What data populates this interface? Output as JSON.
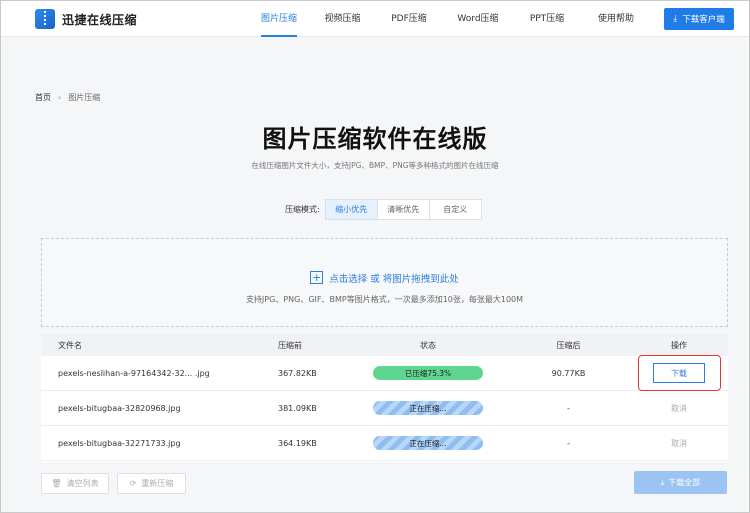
{
  "header": {
    "brand": "迅捷在线压缩",
    "nav": [
      {
        "label": "图片压缩",
        "active": true
      },
      {
        "label": "视频压缩",
        "active": false
      },
      {
        "label": "PDF压缩",
        "active": false
      },
      {
        "label": "Word压缩",
        "active": false
      },
      {
        "label": "PPT压缩",
        "active": false
      },
      {
        "label": "使用帮助",
        "active": false
      }
    ],
    "download_client": "下载客户端"
  },
  "breadcrumb": {
    "home": "首页",
    "current": "图片压缩"
  },
  "page": {
    "title": "图片压缩软件在线版",
    "subtitle": "在线压缩图片文件大小，支持JPG、BMP、PNG等多种格式的图片在线压缩"
  },
  "mode": {
    "label": "压缩模式:",
    "options": [
      "缩小优先",
      "清晰优先",
      "自定义"
    ],
    "selected": "缩小优先"
  },
  "upload": {
    "action": "点击选择 或 将图片拖拽到此处",
    "hint": "支持JPG、PNG、GIF、BMP等图片格式，一次最多添加10张，每张最大100M"
  },
  "table": {
    "headers": [
      "文件名",
      "压缩前",
      "状态",
      "压缩后",
      "操作"
    ],
    "rows": [
      {
        "name": "pexels-neslihan-a-97164342-32... .jpg",
        "before": "367.82KB",
        "state": "已压缩75.3%",
        "state_type": "done",
        "after": "90.77KB",
        "op": "下载"
      },
      {
        "name": "pexels-bitugbaa-32820968.jpg",
        "before": "381.09KB",
        "state": "正在压缩...",
        "state_type": "busy",
        "after": "-",
        "op": "取消"
      },
      {
        "name": "pexels-bitugbaa-32271733.jpg",
        "before": "364.19KB",
        "state": "正在压缩...",
        "state_type": "busy",
        "after": "-",
        "op": "取消"
      }
    ]
  },
  "footer": {
    "clear": "清空列表",
    "recompress": "重新压缩",
    "download_all": "下载全部"
  },
  "colors": {
    "accent": "#2a7de1",
    "done_pill": "#5fd68f",
    "highlight_border": "#e03a2f"
  }
}
